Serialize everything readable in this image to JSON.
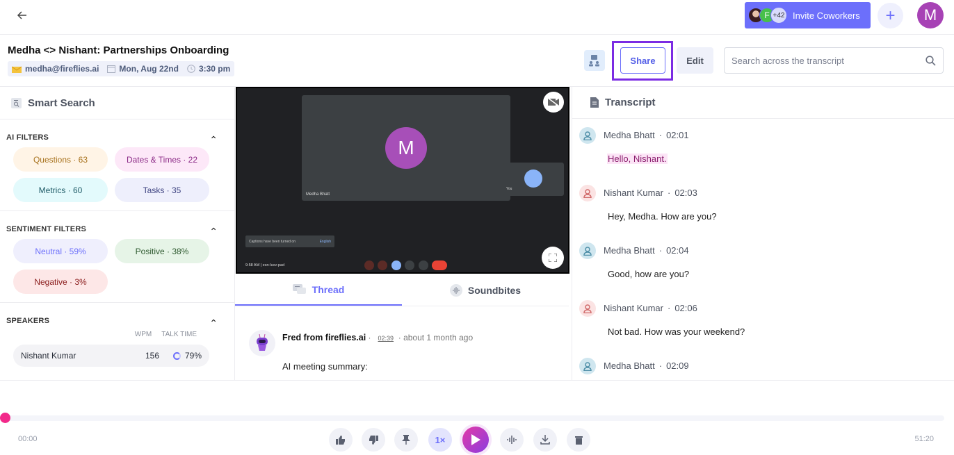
{
  "topbar": {
    "back_icon": "arrow-left-icon",
    "invite": {
      "label": "Invite Coworkers",
      "avatar_initial": "F",
      "extra_count": "+42"
    },
    "plus_label": "+",
    "user_initial": "M"
  },
  "meeting": {
    "title": "Medha <> Nishant: Partnerships Onboarding",
    "email": "medha@fireflies.ai",
    "date": "Mon, Aug 22nd",
    "time": "3:30 pm"
  },
  "actions": {
    "share_label": "Share",
    "edit_label": "Edit",
    "search_placeholder": "Search across the transcript"
  },
  "smart_search": {
    "title": "Smart Search",
    "ai_filters": {
      "title": "AI FILTERS",
      "chips": [
        {
          "label": "Questions · 63",
          "bg": "#fff4e6",
          "fg": "#a8731f"
        },
        {
          "label": "Dates & Times · 22",
          "bg": "#fde8f8",
          "fg": "#8b2a86"
        },
        {
          "label": "Metrics · 60",
          "bg": "#e3fafc",
          "fg": "#1e5a66"
        },
        {
          "label": "Tasks · 35",
          "bg": "#eeeffc",
          "fg": "#3d4280"
        }
      ]
    },
    "sentiment_filters": {
      "title": "SENTIMENT FILTERS",
      "chips": [
        {
          "label": "Neutral · 59%",
          "bg": "#efeffd",
          "fg": "#6c6ffb"
        },
        {
          "label": "Positive · 38%",
          "bg": "#e6f4e7",
          "fg": "#2f5a30"
        },
        {
          "label": "Negative · 3%",
          "bg": "#fde7e7",
          "fg": "#8a1c1c"
        }
      ]
    },
    "speakers": {
      "title": "SPEAKERS",
      "col_wpm": "WPM",
      "col_talk": "TALK TIME",
      "rows": [
        {
          "name": "Nishant Kumar",
          "wpm": "156",
          "talk": "79%"
        }
      ]
    }
  },
  "video": {
    "main_initial": "M",
    "main_name": "Medha Bhatt",
    "self_label": "You",
    "caption_text": "Captions have been turned on",
    "caption_lang": "English",
    "clock": "9:58 AM  |  esn-luvv-pad"
  },
  "tabs": [
    {
      "label": "Thread",
      "active": true
    },
    {
      "label": "Soundbites",
      "active": false
    }
  ],
  "thread": {
    "author": "Fred from fireflies.ai",
    "timestamp": "02:39",
    "ago": "about 1 month ago",
    "body": "AI meeting summary:"
  },
  "transcript": {
    "title": "Transcript",
    "entries": [
      {
        "speaker": "Medha Bhatt",
        "time": "02:01",
        "text": "Hello, Nishant.",
        "highlight": true,
        "color": "medha"
      },
      {
        "speaker": "Nishant Kumar",
        "time": "02:03",
        "text": "Hey, Medha. How are you?",
        "highlight": false,
        "color": "nishant"
      },
      {
        "speaker": "Medha Bhatt",
        "time": "02:04",
        "text": "Good, how are you?",
        "highlight": false,
        "color": "medha"
      },
      {
        "speaker": "Nishant Kumar",
        "time": "02:06",
        "text": "Not bad. How was your weekend?",
        "highlight": false,
        "color": "nishant"
      },
      {
        "speaker": "Medha Bhatt",
        "time": "02:09",
        "text": "",
        "highlight": false,
        "color": "medha"
      }
    ]
  },
  "player": {
    "current": "00:00",
    "total": "51:20",
    "progress_percent": 0,
    "speed_label": "1×"
  },
  "colors": {
    "accent": "#6c6ffb",
    "highlight_border": "#7b2be3",
    "knob": "#f2298a",
    "medha_av": "#cfe6ef",
    "nishant_av": "#fbe3e3"
  }
}
